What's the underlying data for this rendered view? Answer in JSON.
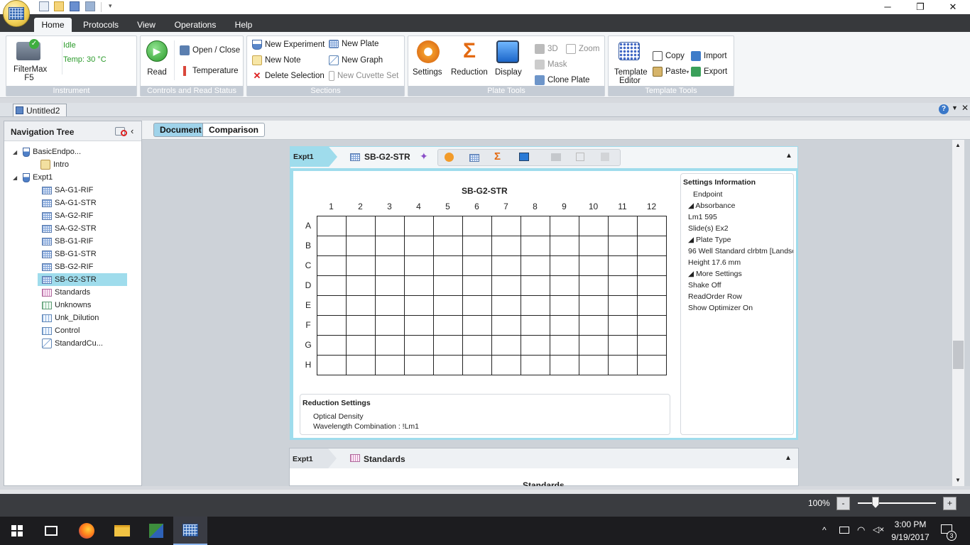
{
  "window": {
    "minimize": "─",
    "restore": "❐",
    "close": "✕"
  },
  "menu": {
    "tabs": [
      "Home",
      "Protocols",
      "View",
      "Operations",
      "Help"
    ],
    "active": "Home"
  },
  "ribbon": {
    "instrument": {
      "name": "FilterMax\nF5",
      "name_line1": "FilterMax",
      "name_line2": "F5",
      "status": "Idle",
      "temp": "Temp: 30 °C",
      "group": "Instrument"
    },
    "controls": {
      "read": "Read",
      "open_close": "Open / Close",
      "temperature": "Temperature",
      "group": "Controls and Read Status"
    },
    "sections": {
      "new_experiment": "New Experiment",
      "new_note": "New Note",
      "delete_selection": "Delete Selection",
      "new_plate": "New Plate",
      "new_graph": "New Graph",
      "new_cuvette_set": "New Cuvette Set",
      "group": "Sections"
    },
    "plate_tools": {
      "settings": "Settings",
      "reduction": "Reduction",
      "display": "Display",
      "three_d": "3D",
      "zoom": "Zoom",
      "mask": "Mask",
      "clone_plate": "Clone Plate",
      "group": "Plate Tools"
    },
    "template_tools": {
      "template_editor_1": "Template",
      "template_editor_2": "Editor",
      "copy": "Copy",
      "paste": "Paste",
      "import": "Import",
      "export": "Export",
      "group": "Template Tools"
    }
  },
  "document": {
    "tab": "Untitled2",
    "help": "?"
  },
  "nav": {
    "title": "Navigation Tree",
    "tree": [
      {
        "label": "BasicEndpo...",
        "level": 0,
        "icon": "flask-icon"
      },
      {
        "label": "Intro",
        "level": 1,
        "icon": "note-icon"
      },
      {
        "label": "Expt1",
        "level": 0,
        "icon": "flask-icon"
      },
      {
        "label": "SA-G1-RIF",
        "level": 1,
        "icon": "plate-icon"
      },
      {
        "label": "SA-G1-STR",
        "level": 1,
        "icon": "plate-icon"
      },
      {
        "label": "SA-G2-RIF",
        "level": 1,
        "icon": "plate-icon"
      },
      {
        "label": "SA-G2-STR",
        "level": 1,
        "icon": "plate-icon"
      },
      {
        "label": "SB-G1-RIF",
        "level": 1,
        "icon": "plate-icon"
      },
      {
        "label": "SB-G1-STR",
        "level": 1,
        "icon": "plate-icon"
      },
      {
        "label": "SB-G2-RIF",
        "level": 1,
        "icon": "plate-icon"
      },
      {
        "label": "SB-G2-STR",
        "level": 1,
        "icon": "plate-icon",
        "selected": true
      },
      {
        "label": "Standards",
        "level": 1,
        "icon": "group-icon"
      },
      {
        "label": "Unknowns",
        "level": 1,
        "icon": "group-icon"
      },
      {
        "label": "Unk_Dilution",
        "level": 1,
        "icon": "group-icon"
      },
      {
        "label": "Control",
        "level": 1,
        "icon": "group-icon"
      },
      {
        "label": "StandardCu...",
        "level": 1,
        "icon": "graph-icon"
      }
    ]
  },
  "view_tabs": {
    "document": "Document",
    "comparison": "Comparison",
    "active": "Document"
  },
  "section1": {
    "expt": "Expt1",
    "plate_name": "SB-G2-STR",
    "plate_title": "SB-G2-STR",
    "columns": [
      "1",
      "2",
      "3",
      "4",
      "5",
      "6",
      "7",
      "8",
      "9",
      "10",
      "11",
      "12"
    ],
    "rows": [
      "A",
      "B",
      "C",
      "D",
      "E",
      "F",
      "G",
      "H"
    ],
    "settings": {
      "title": "Settings Information",
      "lines": [
        "Endpoint",
        "◢ Absorbance",
        "Lm1    595",
        "Slide(s)  Ex2",
        "◢ Plate Type",
        "96 Well Standard clrbtm [Landsc",
        "Height  17.6 mm",
        "◢ More Settings",
        "Shake  Off",
        "ReadOrder  Row",
        "Show Optimizer  On"
      ]
    },
    "reduction": {
      "title": "Reduction Settings",
      "line1": "Optical Density",
      "line2": "Wavelength Combination : !Lm1"
    }
  },
  "section2": {
    "expt": "Expt1",
    "name": "Standards",
    "partial": "Standards"
  },
  "status": {
    "zoom": "100%",
    "minus": "-",
    "plus": "+"
  },
  "taskbar": {
    "time": "3:00 PM",
    "date": "9/19/2017",
    "notifications": "3"
  }
}
